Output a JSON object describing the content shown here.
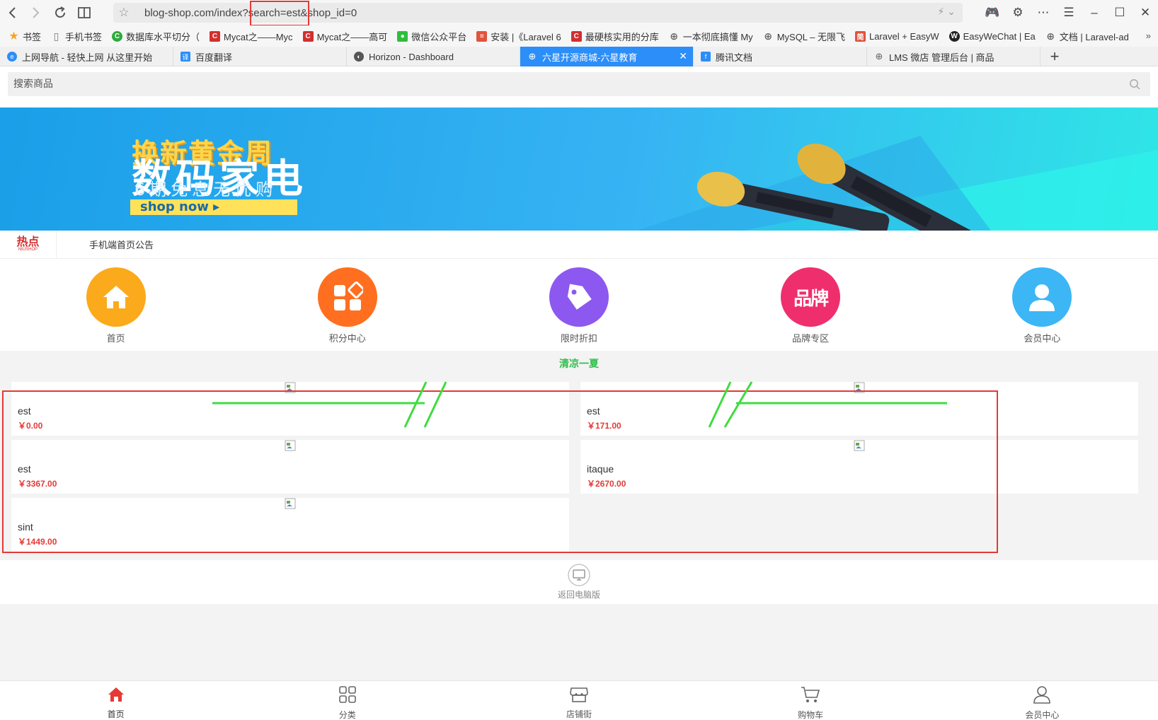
{
  "browser": {
    "url": "blog-shop.com/index?search=est&shop_id=0",
    "bookmarks": [
      {
        "label": "书签",
        "icon": "star-icon",
        "color": "#f5a623"
      },
      {
        "label": "手机书签",
        "icon": "phone-icon",
        "color": "#777777"
      },
      {
        "label": "数据库水平切分（",
        "icon": "circle-c-icon",
        "color": "#2eaa3c"
      },
      {
        "label": "Mycat之——Myc",
        "icon": "csdn-icon",
        "color": "#d32f2f"
      },
      {
        "label": "Mycat之——高可",
        "icon": "csdn-icon",
        "color": "#d32f2f"
      },
      {
        "label": "微信公众平台",
        "icon": "wechat-icon",
        "color": "#2dbf3c"
      },
      {
        "label": "安装 |《Laravel 6",
        "icon": "laravel-icon",
        "color": "#e0533d"
      },
      {
        "label": "最硬核实用的分库",
        "icon": "csdn-icon",
        "color": "#d32f2f"
      },
      {
        "label": "一本彻底搞懂 My",
        "icon": "globe-icon",
        "color": "#666666"
      },
      {
        "label": "MySQL – 无限飞",
        "icon": "globe-icon",
        "color": "#666666"
      },
      {
        "label": "Laravel + EasyW",
        "icon": "jian-icon",
        "color": "#e0533d"
      },
      {
        "label": "EasyWeChat | Ea",
        "icon": "easywechat-icon",
        "color": "#222222"
      },
      {
        "label": "文档 | Laravel-ad",
        "icon": "globe-icon",
        "color": "#666666"
      }
    ],
    "tabs": [
      {
        "label": "上网导航 - 轻快上网 从这里开始",
        "icon": "e-icon",
        "color": "#2c8ef8"
      },
      {
        "label": "百度翻译",
        "icon": "translate-icon",
        "color": "#2c8ef8"
      },
      {
        "label": "Horizon - Dashboard",
        "icon": "horizon-icon",
        "color": "#555555"
      },
      {
        "label": "六星开源商城-六星教育",
        "icon": "globe-icon",
        "color": "#ffffff",
        "active": true
      },
      {
        "label": "腾讯文档",
        "icon": "tencent-doc-icon",
        "color": "#2c8ef8"
      },
      {
        "label": "LMS 微店 管理后台 | 商品",
        "icon": "globe-icon",
        "color": "#666666"
      }
    ]
  },
  "search": {
    "placeholder": "搜索商品"
  },
  "banner": {
    "line1": "换新黄金周",
    "line2": "数码家电",
    "line3": "6期免息无忧购",
    "cta": "shop now ▸"
  },
  "notice": {
    "logo_main": "热点",
    "logo_sub": "NIUSHOP",
    "text": "手机端首页公告"
  },
  "nav": [
    {
      "label": "首页",
      "icon": "home-icon",
      "color": "#fbaa1b"
    },
    {
      "label": "积分中心",
      "icon": "apps-icon",
      "color": "#ff6f1f"
    },
    {
      "label": "限时折扣",
      "icon": "tag-icon",
      "color": "#8d58f0"
    },
    {
      "label": "品牌专区",
      "icon": "brand-icon",
      "color": "#ef2f6d",
      "glyph": "品牌"
    },
    {
      "label": "会员中心",
      "icon": "user-icon",
      "color": "#3cb6f5"
    }
  ],
  "section_title": "清凉一夏",
  "products": [
    {
      "name": "est",
      "price": "￥0.00"
    },
    {
      "name": "est",
      "price": "￥171.00"
    },
    {
      "name": "est",
      "price": "￥3367.00"
    },
    {
      "name": "itaque",
      "price": "￥2670.00"
    },
    {
      "name": "sint",
      "price": "￥1449.00"
    }
  ],
  "pc_version": {
    "label": "返回电脑版"
  },
  "tabbar": [
    {
      "label": "首页",
      "icon": "home-icon",
      "active": true
    },
    {
      "label": "分类",
      "icon": "category-icon"
    },
    {
      "label": "店铺街",
      "icon": "shop-icon"
    },
    {
      "label": "购物车",
      "icon": "cart-icon"
    },
    {
      "label": "会员中心",
      "icon": "user-icon"
    }
  ],
  "colors": {
    "accent": "#e53935",
    "section_title": "#2fbf4a",
    "active_tab": "#2c8ef8",
    "annotation_red": "#e53935",
    "annotation_green": "#3fdc3f"
  }
}
